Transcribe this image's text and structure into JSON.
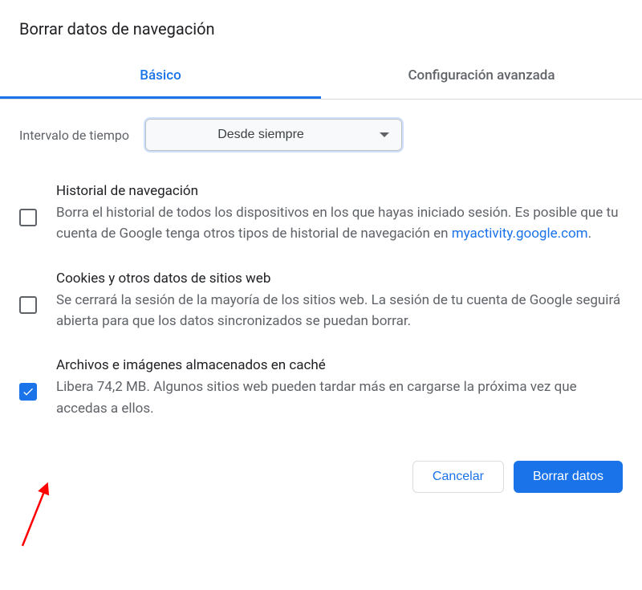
{
  "dialog": {
    "title": "Borrar datos de navegación"
  },
  "tabs": {
    "basic": "Básico",
    "advanced": "Configuración avanzada"
  },
  "timeRange": {
    "label": "Intervalo de tiempo",
    "value": "Desde siempre"
  },
  "options": {
    "browsingHistory": {
      "title": "Historial de navegación",
      "descriptionPrefix": "Borra el historial de todos los dispositivos en los que hayas iniciado sesión. Es posible que tu cuenta de Google tenga otros tipos de historial de navegación en ",
      "link": "myactivity.google.com",
      "descriptionSuffix": ".",
      "checked": false
    },
    "cookies": {
      "title": "Cookies y otros datos de sitios web",
      "description": "Se cerrará la sesión de la mayoría de los sitios web. La sesión de tu cuenta de Google seguirá abierta para que los datos sincronizados se puedan borrar.",
      "checked": false
    },
    "cache": {
      "title": "Archivos e imágenes almacenados en caché",
      "description": "Libera 74,2 MB. Algunos sitios web pueden tardar más en cargarse la próxima vez que accedas a ellos.",
      "checked": true
    }
  },
  "buttons": {
    "cancel": "Cancelar",
    "clear": "Borrar datos"
  }
}
